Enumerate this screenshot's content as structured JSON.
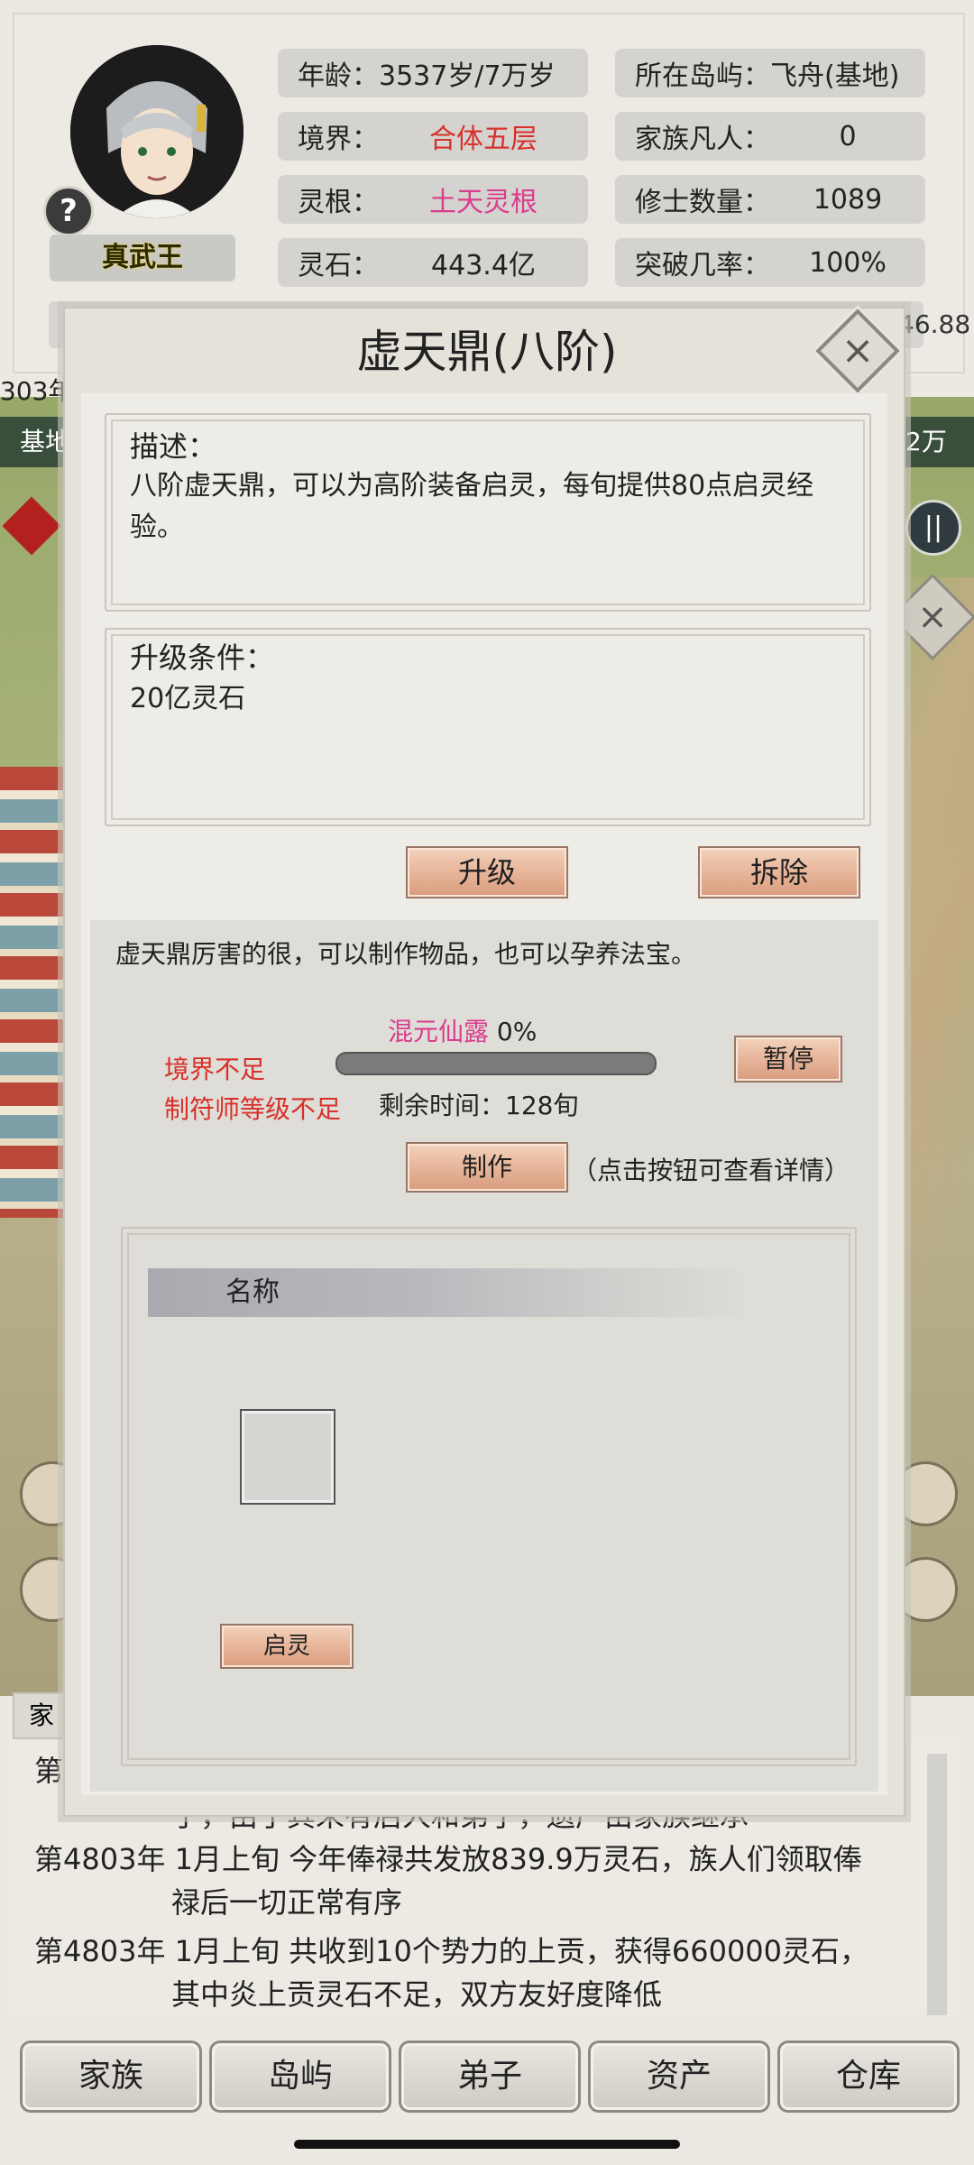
{
  "character": {
    "name": "真武王",
    "age": "年龄：3537岁/7万岁",
    "realm_label": "境界：",
    "realm_value": "合体五层",
    "root_label": "灵根：",
    "root_value": "土天灵根",
    "stones_label": "灵石：",
    "stones_value": "443.4亿",
    "island_label": "所在岛屿：",
    "island_value": "飞舟(基地)",
    "mortals_label": "家族凡人：",
    "mortals_value": "0",
    "cultivators_label": "修士数量：",
    "cultivators_value": "1089",
    "breakthrough_label": "突破几率：",
    "breakthrough_value": "100%",
    "cut_number": "46.88",
    "help_icon": "?"
  },
  "background": {
    "year_fragment": "303年",
    "tab_left": "基地",
    "tab_right": "2万",
    "pause_icon": "||",
    "close_icon": "×"
  },
  "modal": {
    "title": "虚天鼎(八阶)",
    "close_icon": "×",
    "description_title": "描述：",
    "description_text": "八阶虚天鼎，可以为高阶装备启灵，每旬提供80点启灵经验。",
    "upgrade_title": "升级条件：",
    "upgrade_text": "20亿灵石",
    "upgrade_button": "升级",
    "dismantle_button": "拆除",
    "craft_intro": "虚天鼎厉害的很，可以制作物品，也可以孕养法宝。",
    "item_name": "混元仙露",
    "progress_text": "0%",
    "progress": 0,
    "remaining_time": "剩余时间：128旬",
    "pause_button": "暂停",
    "warning_1": "境界不足",
    "warning_2": "制符师等级不足",
    "make_button": "制作",
    "make_hint": "（点击按钮可查看详情）",
    "list_header": "名称",
    "awaken_button": "启灵"
  },
  "log": {
    "partial_prefix": "第",
    "partial_left_tab": "家",
    "line0": "了，由于其未有后人和弟子，遗产由家族继承",
    "line1a": "第4803年 1月上旬 今年俸禄共发放839.9万灵石，族人们领取俸",
    "line1b": "禄后一切正常有序",
    "line2a": "第4803年 1月上旬 共收到10个势力的上贡，获得660000灵石，",
    "line2b": "其中炎上贡灵石不足，双方友好度降低"
  },
  "bottom_tabs": [
    "家族",
    "岛屿",
    "弟子",
    "资产",
    "仓库"
  ],
  "colors": {
    "accent_red": "#d8302a",
    "accent_pink": "#db3c8c",
    "copper_button": "#e8b89d"
  }
}
